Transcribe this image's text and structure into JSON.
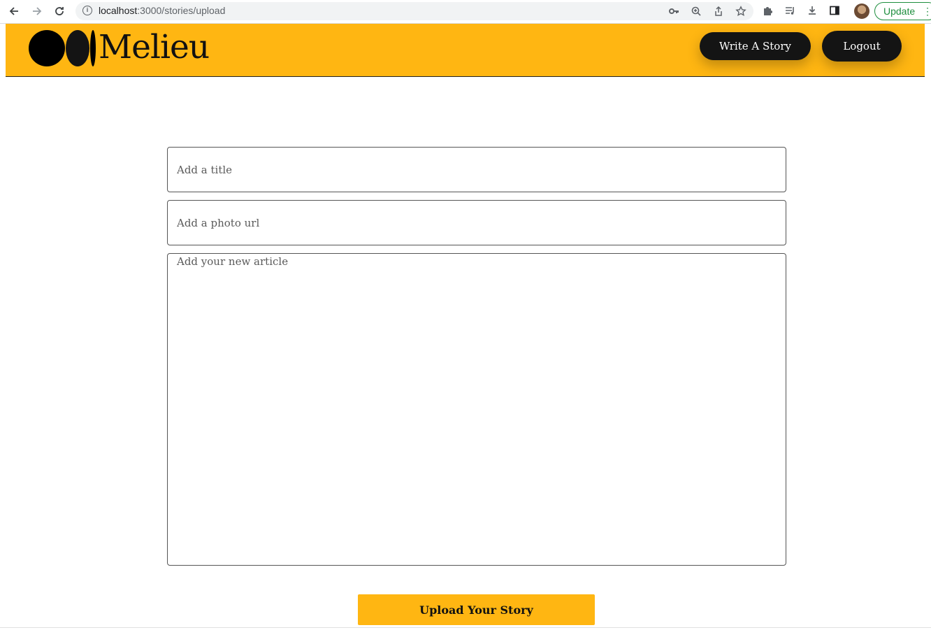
{
  "browser": {
    "url_host": "localhost",
    "url_path": ":3000/stories/upload",
    "update_label": "Update"
  },
  "header": {
    "brand": "Melieu",
    "write_label": "Write A Story",
    "logout_label": "Logout",
    "accent_color": "#ffb612"
  },
  "form": {
    "title_placeholder": "Add a title",
    "photo_placeholder": "Add a photo url",
    "article_placeholder": "Add your new article",
    "submit_label": "Upload Your Story"
  }
}
